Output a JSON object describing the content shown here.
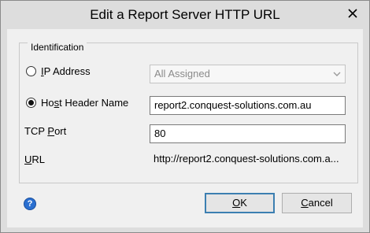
{
  "window": {
    "title": "Edit a Report Server HTTP URL"
  },
  "identification": {
    "group_label": "Identification",
    "ip_address": {
      "label_pre": "",
      "label_key": "I",
      "label_post": "P Address",
      "selected": false,
      "dropdown_value": "All Assigned",
      "enabled": false
    },
    "host_header": {
      "label_pre": "Ho",
      "label_key": "s",
      "label_post": "t Header Name",
      "selected": true,
      "value": "report2.conquest-solutions.com.au"
    },
    "tcp_port": {
      "label_pre": "TCP ",
      "label_key": "P",
      "label_post": "ort",
      "value": "80"
    },
    "url": {
      "label_pre": "",
      "label_key": "U",
      "label_post": "RL",
      "value": "http://report2.conquest-solutions.com.a..."
    }
  },
  "buttons": {
    "ok_key": "O",
    "ok_rest": "K",
    "cancel_key": "C",
    "cancel_rest": "ancel"
  },
  "icons": {
    "help": "help-icon",
    "help_glyph": "?",
    "close": "close-icon",
    "dropdown": "chevron-down-icon"
  }
}
